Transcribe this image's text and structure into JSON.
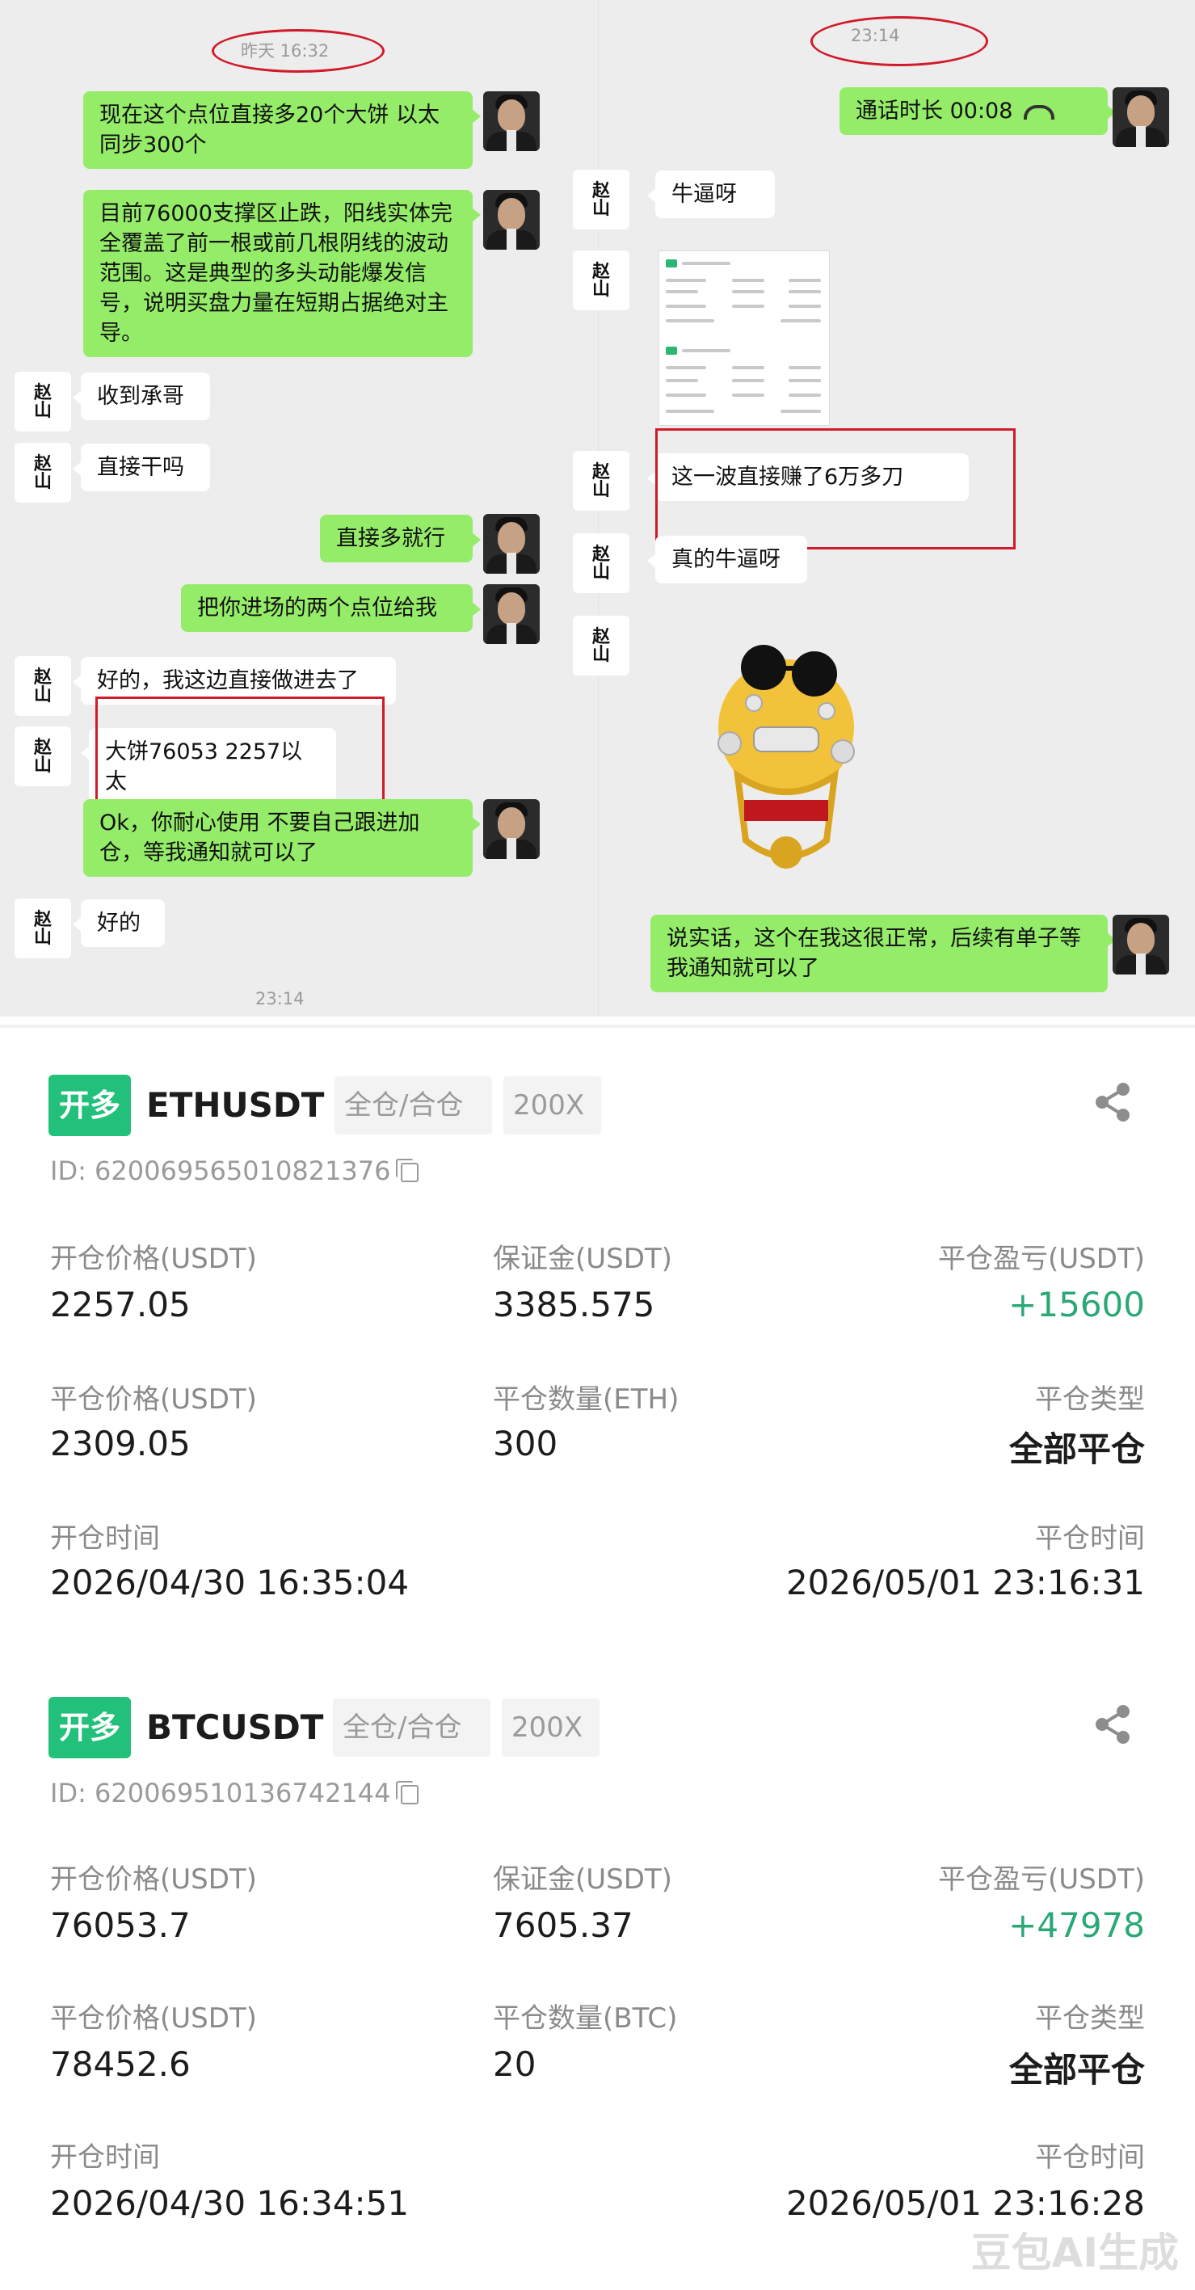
{
  "chat": {
    "left": {
      "top_time": "昨天 16:32",
      "bottom_time": "23:14",
      "messages": [
        {
          "text": "现在这个点位直接多20个大饼 以太同步300个"
        },
        {
          "text": "目前76000支撑区止跌，阳线实体完全覆盖了前一根或前几根阴线的波动范围。这是典型的多头动能爆发信号，说明买盘力量在短期占据绝对主导。"
        },
        {
          "text": "收到承哥"
        },
        {
          "text": "直接干吗"
        },
        {
          "text": "直接多就行"
        },
        {
          "text": "把你进场的两个点位给我"
        },
        {
          "text": "好的，我这边直接做进去了"
        },
        {
          "text": "大饼76053 2257以太"
        },
        {
          "text": "Ok，你耐心使用 不要自己跟进加仓，等我通知就可以了"
        },
        {
          "text": "好的"
        }
      ]
    },
    "right": {
      "top_time": "23:14",
      "messages": [
        {
          "text": "通话时长 00:08"
        },
        {
          "text": "牛逼呀"
        },
        {
          "text": "这一波直接赚了6万多刀"
        },
        {
          "text": "真的牛逼呀"
        },
        {
          "text": "说实话，这个在我这很正常，后续有单子等我通知就可以了"
        }
      ]
    },
    "contact_avatar_glyph": [
      "赵",
      "山"
    ]
  },
  "trades": [
    {
      "direction": "开多",
      "symbol": "ETHUSDT",
      "margin_mode": "全仓/合仓",
      "leverage": "200X",
      "id": "ID: 620069565010821376",
      "open_price_label": "开仓价格(USDT)",
      "open_price": "2257.05",
      "margin_label": "保证金(USDT)",
      "margin": "3385.575",
      "pnl_label": "平仓盈亏(USDT)",
      "pnl": "+15600",
      "close_price_label": "平仓价格(USDT)",
      "close_price": "2309.05",
      "close_qty_label": "平仓数量(ETH)",
      "close_qty": "300",
      "close_type_label": "平仓类型",
      "close_type": "全部平仓",
      "open_time_label": "开仓时间",
      "open_time": "2026/04/30 16:35:04",
      "close_time_label": "平仓时间",
      "close_time": "2026/05/01 23:16:31"
    },
    {
      "direction": "开多",
      "symbol": "BTCUSDT",
      "margin_mode": "全仓/合仓",
      "leverage": "200X",
      "id": "ID: 620069510136742144",
      "open_price_label": "开仓价格(USDT)",
      "open_price": "76053.7",
      "margin_label": "保证金(USDT)",
      "margin": "7605.37",
      "pnl_label": "平仓盈亏(USDT)",
      "pnl": "+47978",
      "close_price_label": "平仓价格(USDT)",
      "close_price": "78452.6",
      "close_qty_label": "平仓数量(BTC)",
      "close_qty": "20",
      "close_type_label": "平仓类型",
      "close_type": "全部平仓",
      "open_time_label": "开仓时间",
      "open_time": "2026/04/30 16:34:51",
      "close_time_label": "平仓时间",
      "close_time": "2026/05/01 23:16:28"
    }
  ],
  "watermark": "豆包AI生成",
  "colors": {
    "chat_bg": "#ededed",
    "bubble_green": "#95ec69",
    "highlight_red": "#d11a2a",
    "badge_green": "#22c07a",
    "profit_green": "#2aa876"
  }
}
